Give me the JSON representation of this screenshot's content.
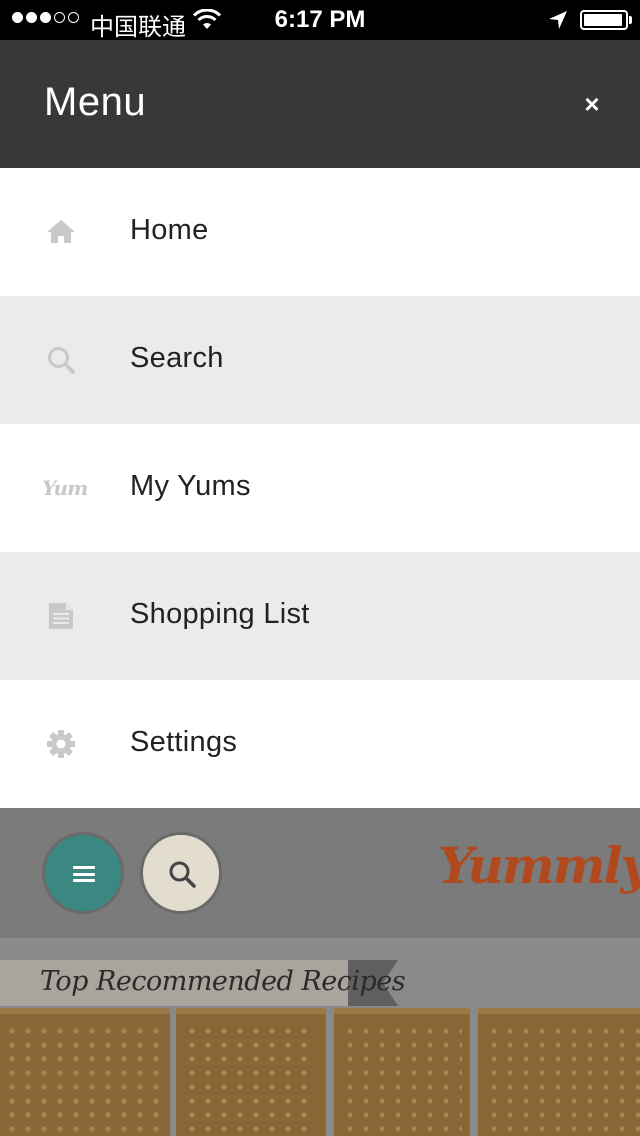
{
  "status_bar": {
    "carrier": "中国联通",
    "time": "6:17 PM",
    "signal_filled": 3,
    "signal_total": 5,
    "battery_level": 0.95
  },
  "menu": {
    "title": "Menu",
    "close_glyph": "×",
    "items": [
      {
        "label": "Home",
        "icon": "home-icon"
      },
      {
        "label": "Search",
        "icon": "search-icon"
      },
      {
        "label": "My Yums",
        "icon": "yum-icon",
        "icon_text": "Yum"
      },
      {
        "label": "Shopping List",
        "icon": "document-icon"
      },
      {
        "label": "Settings",
        "icon": "gear-icon"
      }
    ]
  },
  "background_app": {
    "logo": "Yummly",
    "logo_tm": "™",
    "section_title": "Top Recommended Recipes"
  },
  "colors": {
    "header": "#383838",
    "alt_row": "#ebebeb",
    "icon_gray": "#c9c9c9",
    "teal": "#3b8882",
    "logo": "#b04a1e"
  }
}
